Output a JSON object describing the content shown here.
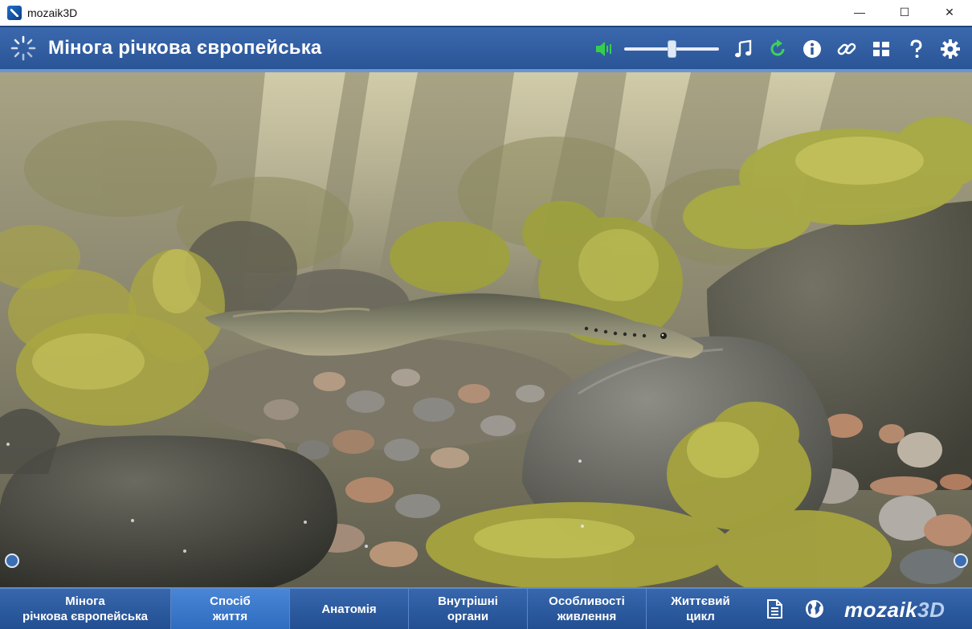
{
  "window": {
    "title": "mozaik3D",
    "controls": {
      "minimize": "—",
      "maximize": "☐",
      "close": "✕"
    }
  },
  "header": {
    "title": "Мінога річкова європейська",
    "volume_level": 0.5,
    "tools": [
      "speaker-icon",
      "volume-slider",
      "music-icon",
      "refresh-icon",
      "info-icon",
      "link-icon",
      "grid-icon",
      "help-icon",
      "gear-icon"
    ]
  },
  "tabs": [
    {
      "line1": "Мінога",
      "line2": "річкова європейська",
      "active": false
    },
    {
      "line1": "Спосіб",
      "line2": "життя",
      "active": true
    },
    {
      "line1": "Анатомія",
      "line2": "",
      "active": false
    },
    {
      "line1": "Внутрішні",
      "line2": "органи",
      "active": false
    },
    {
      "line1": "Особливості",
      "line2": "живлення",
      "active": false
    },
    {
      "line1": "Життєвий",
      "line2": "цикл",
      "active": false
    }
  ],
  "brand": {
    "main": "mozaik",
    "suffix": "3D"
  },
  "colors": {
    "header_blue": "#2f5a9d",
    "tab_active": "#3a78cc",
    "speaker_green": "#35d04a",
    "refresh_green": "#3ed15a"
  }
}
